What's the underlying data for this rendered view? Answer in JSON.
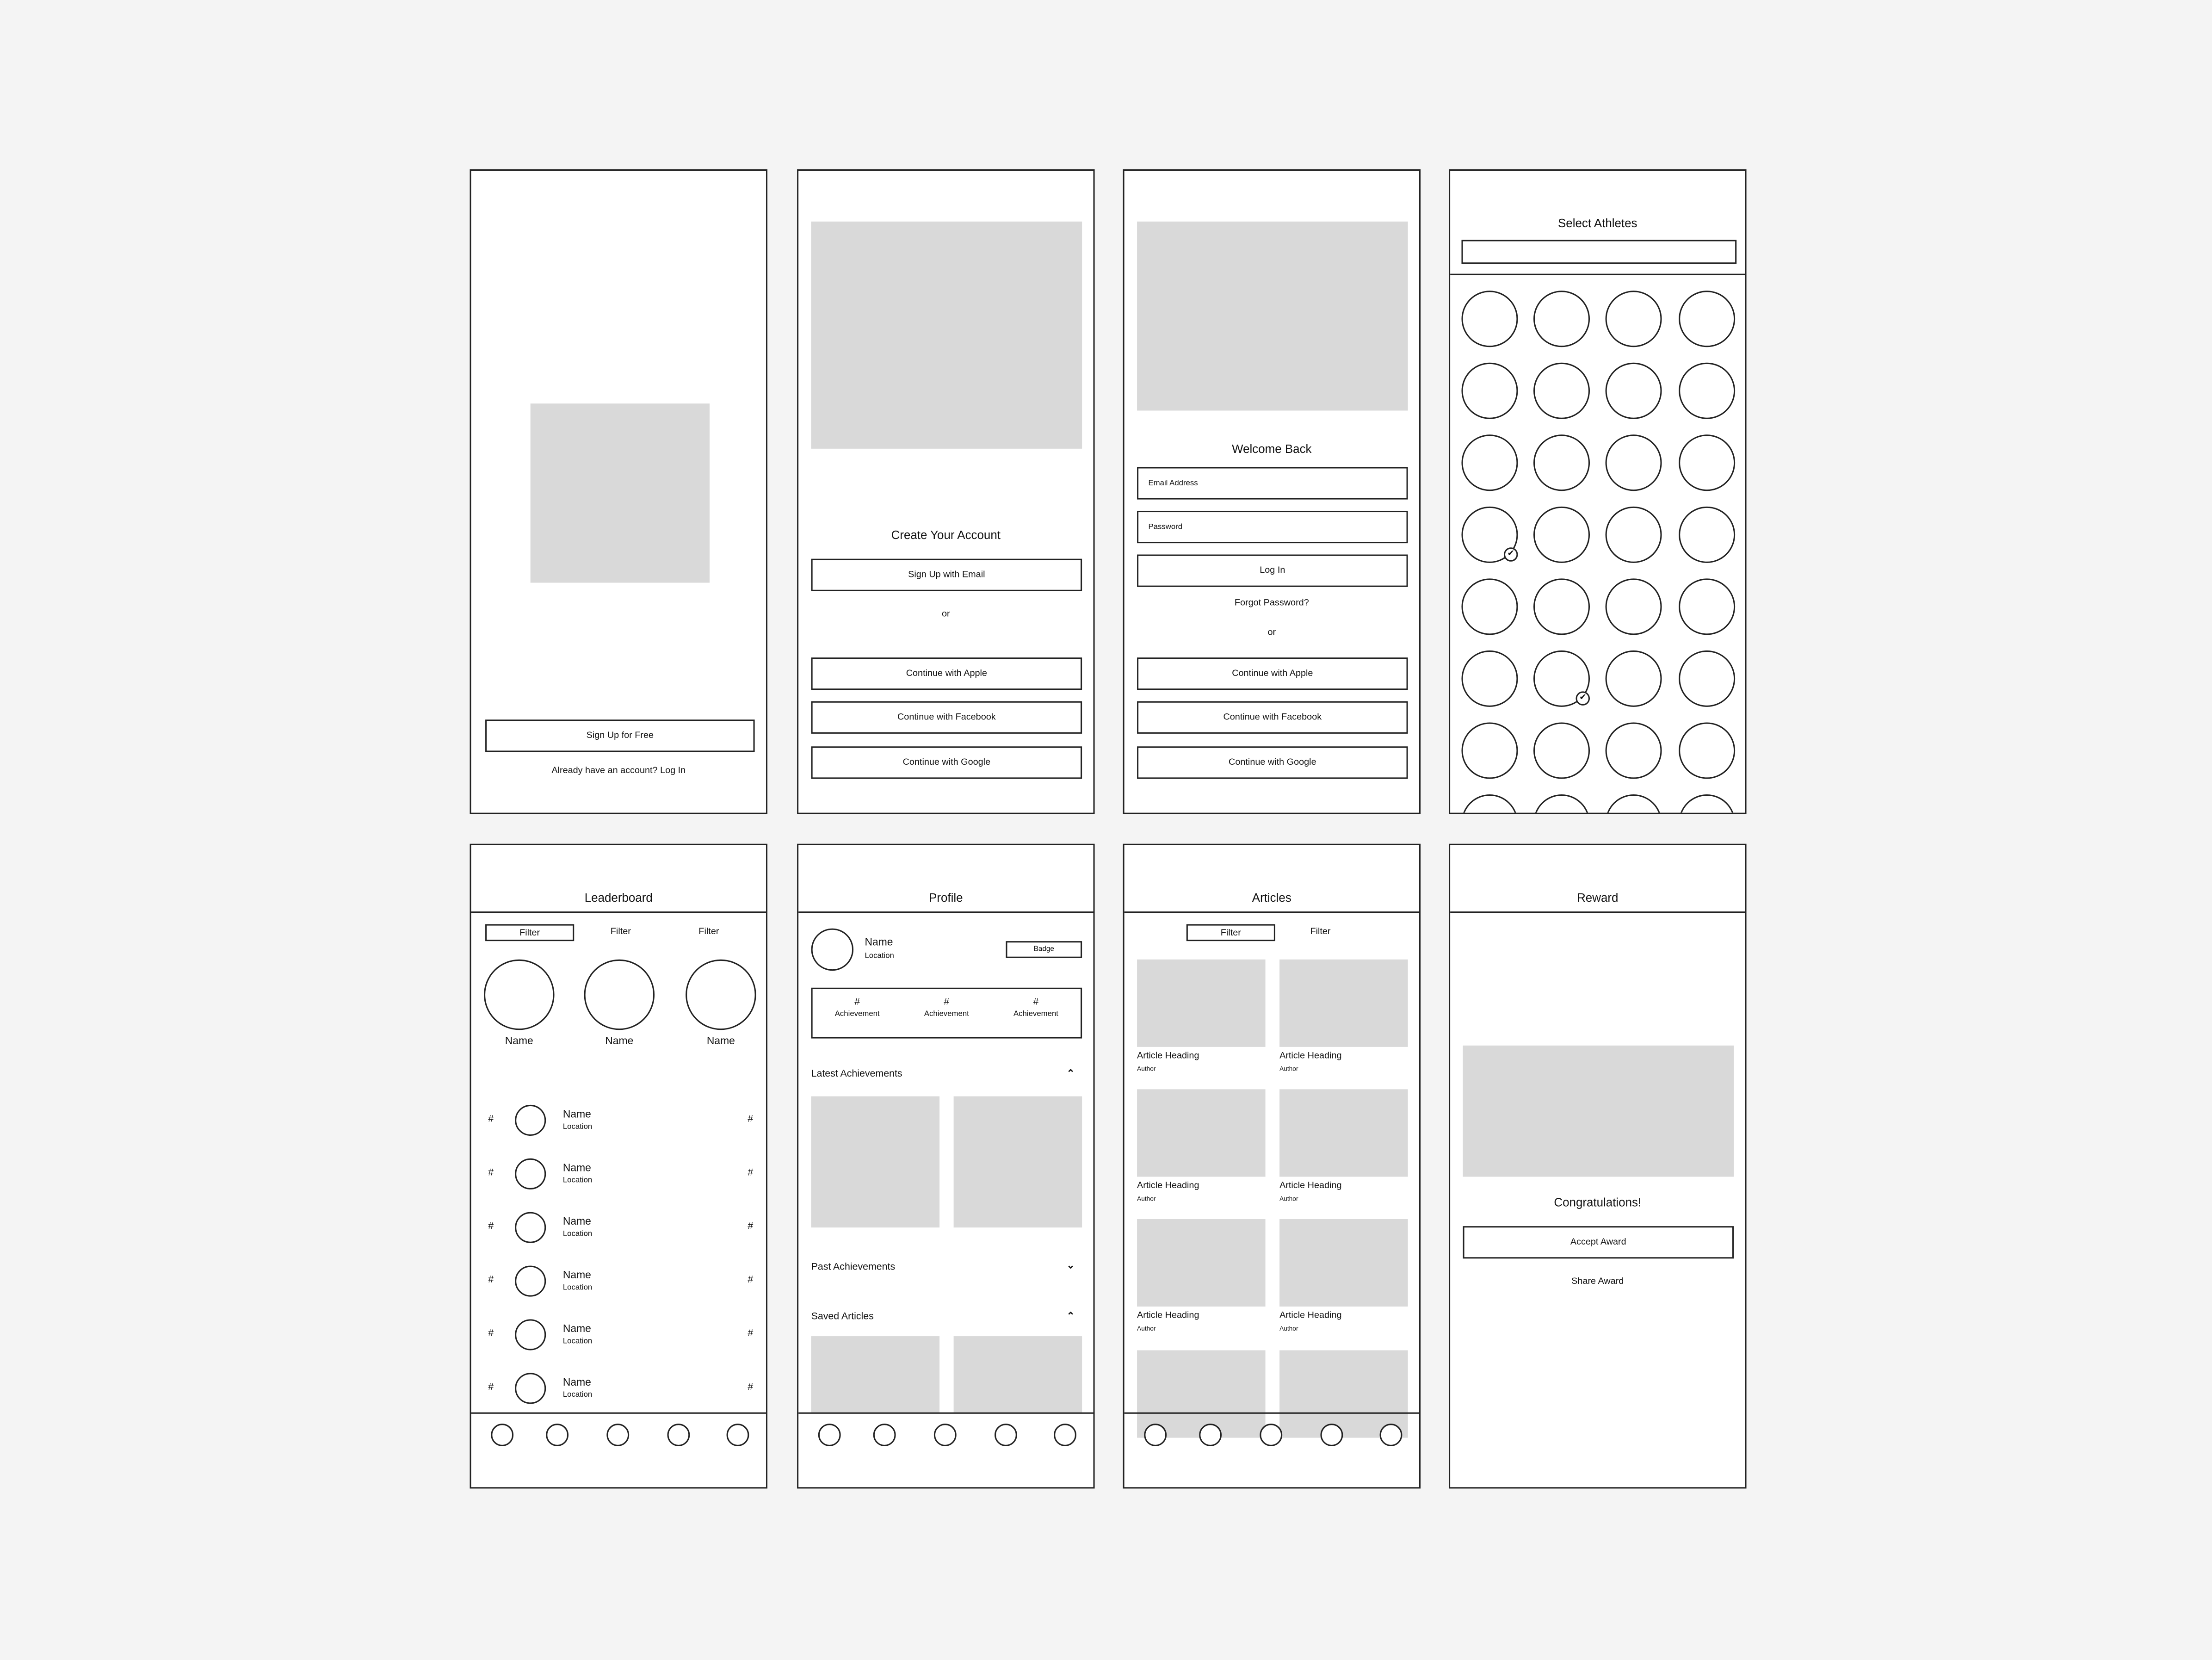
{
  "screens": {
    "splash": {
      "primary_button": "Sign Up for Free",
      "login_link": "Already have an account? Log In"
    },
    "create_account": {
      "title": "Create Your Account",
      "email_button": "Sign Up with Email",
      "divider": "or",
      "apple_button": "Continue with Apple",
      "facebook_button": "Continue with Facebook",
      "google_button": "Continue with Google"
    },
    "login": {
      "title": "Welcome Back",
      "email_placeholder": "Email Address",
      "password_placeholder": "Password",
      "login_button": "Log In",
      "forgot_link": "Forgot Password?",
      "divider": "or",
      "apple_button": "Continue with Apple",
      "facebook_button": "Continue with Facebook",
      "google_button": "Continue with Google"
    },
    "select_athletes": {
      "title": "Select Athletes",
      "search_value": "",
      "checked_icon": "check-icon"
    },
    "leaderboard": {
      "title": "Leaderboard",
      "filters": [
        "Filter",
        "Filter",
        "Filter"
      ],
      "podium": [
        "Name",
        "Name",
        "Name"
      ],
      "rows": [
        {
          "rank": "#",
          "name": "Name",
          "location": "Location",
          "score": "#"
        },
        {
          "rank": "#",
          "name": "Name",
          "location": "Location",
          "score": "#"
        },
        {
          "rank": "#",
          "name": "Name",
          "location": "Location",
          "score": "#"
        },
        {
          "rank": "#",
          "name": "Name",
          "location": "Location",
          "score": "#"
        },
        {
          "rank": "#",
          "name": "Name",
          "location": "Location",
          "score": "#"
        },
        {
          "rank": "#",
          "name": "Name",
          "location": "Location",
          "score": "#"
        }
      ]
    },
    "profile": {
      "title": "Profile",
      "name": "Name",
      "location": "Location",
      "badge": "Badge",
      "stats": [
        {
          "value": "#",
          "label": "Achievement"
        },
        {
          "value": "#",
          "label": "Achievement"
        },
        {
          "value": "#",
          "label": "Achievement"
        }
      ],
      "sections": {
        "latest": "Latest Achievements",
        "past": "Past Achievements",
        "saved": "Saved Articles"
      }
    },
    "articles": {
      "title": "Articles",
      "filters": [
        "Filter",
        "Filter"
      ],
      "items": [
        {
          "heading": "Article Heading",
          "author": "Author"
        },
        {
          "heading": "Article Heading",
          "author": "Author"
        },
        {
          "heading": "Article Heading",
          "author": "Author"
        },
        {
          "heading": "Article Heading",
          "author": "Author"
        },
        {
          "heading": "Article Heading",
          "author": "Author"
        },
        {
          "heading": "Article Heading",
          "author": "Author"
        }
      ]
    },
    "reward": {
      "title": "Reward",
      "message": "Congratulations!",
      "accept_button": "Accept Award",
      "share_link": "Share Award"
    }
  },
  "colors": {
    "background": "#f4f4f4",
    "frame": "#ffffff",
    "stroke": "#222222",
    "placeholder": "#d9d9d9"
  }
}
